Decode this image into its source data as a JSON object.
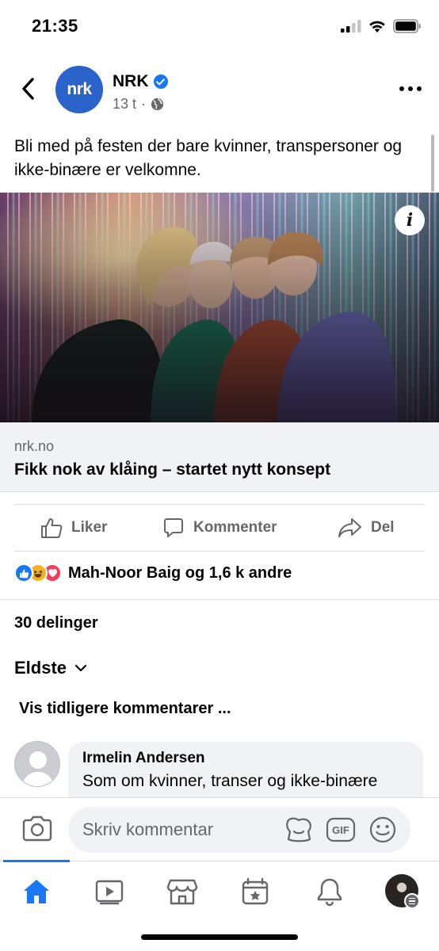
{
  "status_bar": {
    "time": "21:35"
  },
  "post": {
    "page_name": "NRK",
    "avatar_text": "nrk",
    "time_ago": "13 t",
    "meta_separator": "·",
    "text": "Bli med på festen der bare kvinner, transpersoner og ikke-binære er velkomne.",
    "info_label": "i",
    "link": {
      "domain": "nrk.no",
      "title": "Fikk nok av klåing – startet nytt konsept"
    }
  },
  "actions": {
    "like": "Liker",
    "comment": "Kommenter",
    "share": "Del"
  },
  "reactions": {
    "summary": "Mah-Noor Baig og 1,6 k andre",
    "types": [
      "like-icon",
      "haha-icon",
      "love-icon"
    ]
  },
  "shares": "30 delinger",
  "comments": {
    "sort_label": "Eldste",
    "view_earlier": "Vis tidligere kommentarer ...",
    "items": [
      {
        "author": "Irmelin Andersen",
        "text": "Som om kvinner, transer og ikke-binære"
      }
    ]
  },
  "composer": {
    "placeholder": "Skriv kommentar",
    "gif_label": "GIF"
  },
  "colors": {
    "accent": "#1877f2",
    "nrk_blue": "#2a63c9",
    "secondary_text": "#65676b",
    "love": "#f33e58",
    "haha": "#f7b125"
  }
}
